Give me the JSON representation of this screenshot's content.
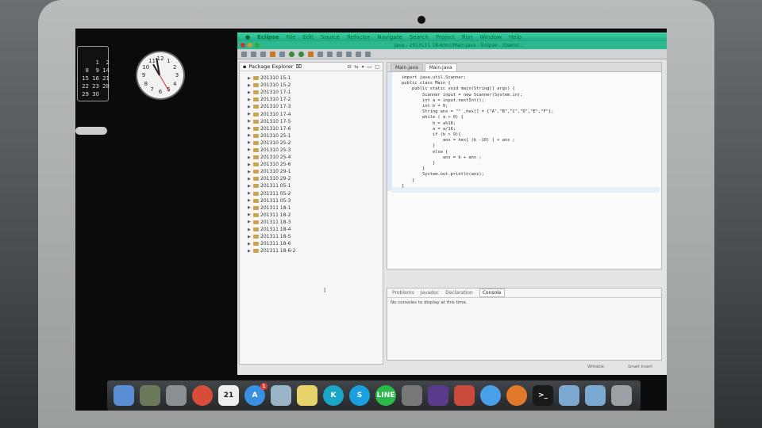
{
  "calendar": {
    "days": [
      "1",
      "2",
      "8",
      "9",
      "14",
      "15",
      "16",
      "21",
      "22",
      "23",
      "28",
      "29",
      "30"
    ]
  },
  "clock": {
    "numbers": [
      "12",
      "1",
      "2",
      "3",
      "4",
      "5",
      "6",
      "7",
      "8",
      "9",
      "10",
      "11"
    ]
  },
  "menubar": {
    "app": "Eclipse",
    "items": [
      "File",
      "Edit",
      "Source",
      "Refactor",
      "Navigate",
      "Search",
      "Project",
      "Run",
      "Window",
      "Help"
    ]
  },
  "window": {
    "title": "Java - 2013111 18-6/src/Main.java - Eclipse - /Users/..."
  },
  "package_explorer": {
    "title": "Package Explorer",
    "items": [
      "201310 15-1",
      "201310 15-2",
      "201310 17-1",
      "201310 17-2",
      "201310 17-3",
      "201310 17-4",
      "201310 17-5",
      "201310 17-6",
      "201310 25-1",
      "201310 25-2",
      "201310 25-3",
      "201310 25-4",
      "201310 25-6",
      "201310 29-1",
      "201310 29-2",
      "201311 05-1",
      "201311 05-2",
      "201311 05-3",
      "201311 18-1",
      "201311 18-2",
      "201311 18-3",
      "201311 18-4",
      "201311 18-5",
      "201311 18-6",
      "201311 18-6-2"
    ]
  },
  "editor": {
    "tabs": [
      "Main.java",
      "Main.java"
    ],
    "active_tab": 1,
    "code": [
      "import java.util.Scanner;",
      "public class Main {",
      "    public static void main(String[] args) {",
      "        Scanner input = new Scanner(System.in);",
      "        int a = input.nextInt();",
      "        int b = 0;",
      "        String ans = \"\" ,hex[] = {\"A\",\"B\",\"C\",\"D\",\"E\",\"F\"};",
      "        while ( a > 0) {",
      "            b = a%16;",
      "            a = a/16;",
      "            if (b > 9){",
      "                ans = hex[ (b -10) ] + ans ;",
      "            }",
      "            else {",
      "                ans = b + ans ;",
      "            }",
      "        }",
      "        System.out.println(ans);",
      "    }",
      "}"
    ]
  },
  "console": {
    "tabs": [
      "Problems",
      "Javadoc",
      "Declaration",
      "Console"
    ],
    "active_tab": "Console",
    "message": "No consoles to display at this time."
  },
  "statusbar": {
    "mode": "Writable",
    "insert": "Smart Insert"
  },
  "dock": {
    "icons": [
      {
        "name": "finder-icon",
        "color": "#5a8fd6",
        "glyph": ""
      },
      {
        "name": "photo-icon",
        "color": "#6a7a5a",
        "glyph": ""
      },
      {
        "name": "rocket-icon",
        "color": "#8a8f96",
        "glyph": ""
      },
      {
        "name": "chrome-icon",
        "color": "#d84c3a",
        "glyph": ""
      },
      {
        "name": "calendar-icon",
        "color": "#eeeeee",
        "glyph": "21"
      },
      {
        "name": "app-store-icon",
        "color": "#3a8fe0",
        "glyph": "A",
        "badge": "1"
      },
      {
        "name": "preview-icon",
        "color": "#9ab4c8",
        "glyph": ""
      },
      {
        "name": "notes-icon",
        "color": "#e8d36a",
        "glyph": ""
      },
      {
        "name": "kakao-icon",
        "color": "#1aa7c8",
        "glyph": "K"
      },
      {
        "name": "skype-icon",
        "color": "#1aa0e0",
        "glyph": "S"
      },
      {
        "name": "line-icon",
        "color": "#2cb84a",
        "glyph": "LINE"
      },
      {
        "name": "grid-app-icon",
        "color": "#777777",
        "glyph": ""
      },
      {
        "name": "eclipse-icon",
        "color": "#5a3a8a",
        "glyph": ""
      },
      {
        "name": "crossover-icon",
        "color": "#c84a3a",
        "glyph": ""
      },
      {
        "name": "messages-icon",
        "color": "#4aa0e8",
        "glyph": ""
      },
      {
        "name": "ball-icon",
        "color": "#e07a2a",
        "glyph": ""
      },
      {
        "name": "terminal-icon",
        "color": "#1a1a1a",
        "glyph": ">_"
      },
      {
        "name": "folder-icon",
        "color": "#7aa8d0",
        "glyph": ""
      },
      {
        "name": "folder-icon-2",
        "color": "#7aa8d0",
        "glyph": ""
      },
      {
        "name": "trash-icon",
        "color": "#9aa0a6",
        "glyph": ""
      }
    ]
  }
}
